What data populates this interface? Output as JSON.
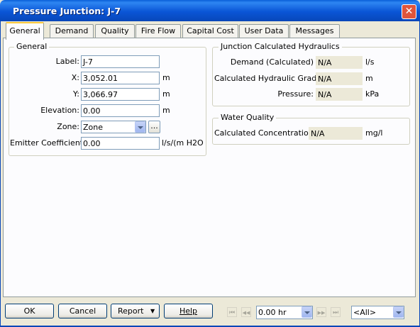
{
  "window": {
    "title": "Pressure Junction: J-7",
    "close_glyph": "✕"
  },
  "tabs": [
    {
      "label": "General"
    },
    {
      "label": "Demand"
    },
    {
      "label": "Quality"
    },
    {
      "label": "Fire Flow"
    },
    {
      "label": "Capital Cost"
    },
    {
      "label": "User Data"
    },
    {
      "label": "Messages"
    }
  ],
  "active_tab": "General",
  "general": {
    "title": "General",
    "label_label": "Label:",
    "label_value": "J-7",
    "x_label": "X:",
    "x_value": "3,052.01",
    "x_unit": "m",
    "y_label": "Y:",
    "y_value": "3,066.97",
    "y_unit": "m",
    "elevation_label": "Elevation:",
    "elevation_value": "0.00",
    "elevation_unit": "m",
    "zone_label": "Zone:",
    "zone_value": "Zone",
    "zone_browse": "...",
    "emitter_label": "Emitter Coefficient:",
    "emitter_value": "0.00",
    "emitter_unit": "l/s/(m H2O"
  },
  "hydraulics": {
    "title": "Junction Calculated Hydraulics",
    "demand_label": "Demand (Calculated)",
    "demand_value": "N/A",
    "demand_unit": "l/s",
    "hgl_label": "Calculated Hydraulic Grade:",
    "hgl_value": "N/A",
    "hgl_unit": "m",
    "pressure_label": "Pressure:",
    "pressure_value": "N/A",
    "pressure_unit": "kPa"
  },
  "water_quality": {
    "title": "Water Quality",
    "conc_label": "Calculated Concentration:",
    "conc_value": "N/A",
    "conc_unit": "mg/l"
  },
  "footer": {
    "ok_label": "OK",
    "cancel_label": "Cancel",
    "report_label": "Report",
    "help_label": "Help",
    "time_value": "0.00 hr",
    "filter_value": "<All>",
    "nav_first": "⏮",
    "nav_prev": "◀◀",
    "nav_next": "▶▶",
    "nav_last": "⏭"
  }
}
